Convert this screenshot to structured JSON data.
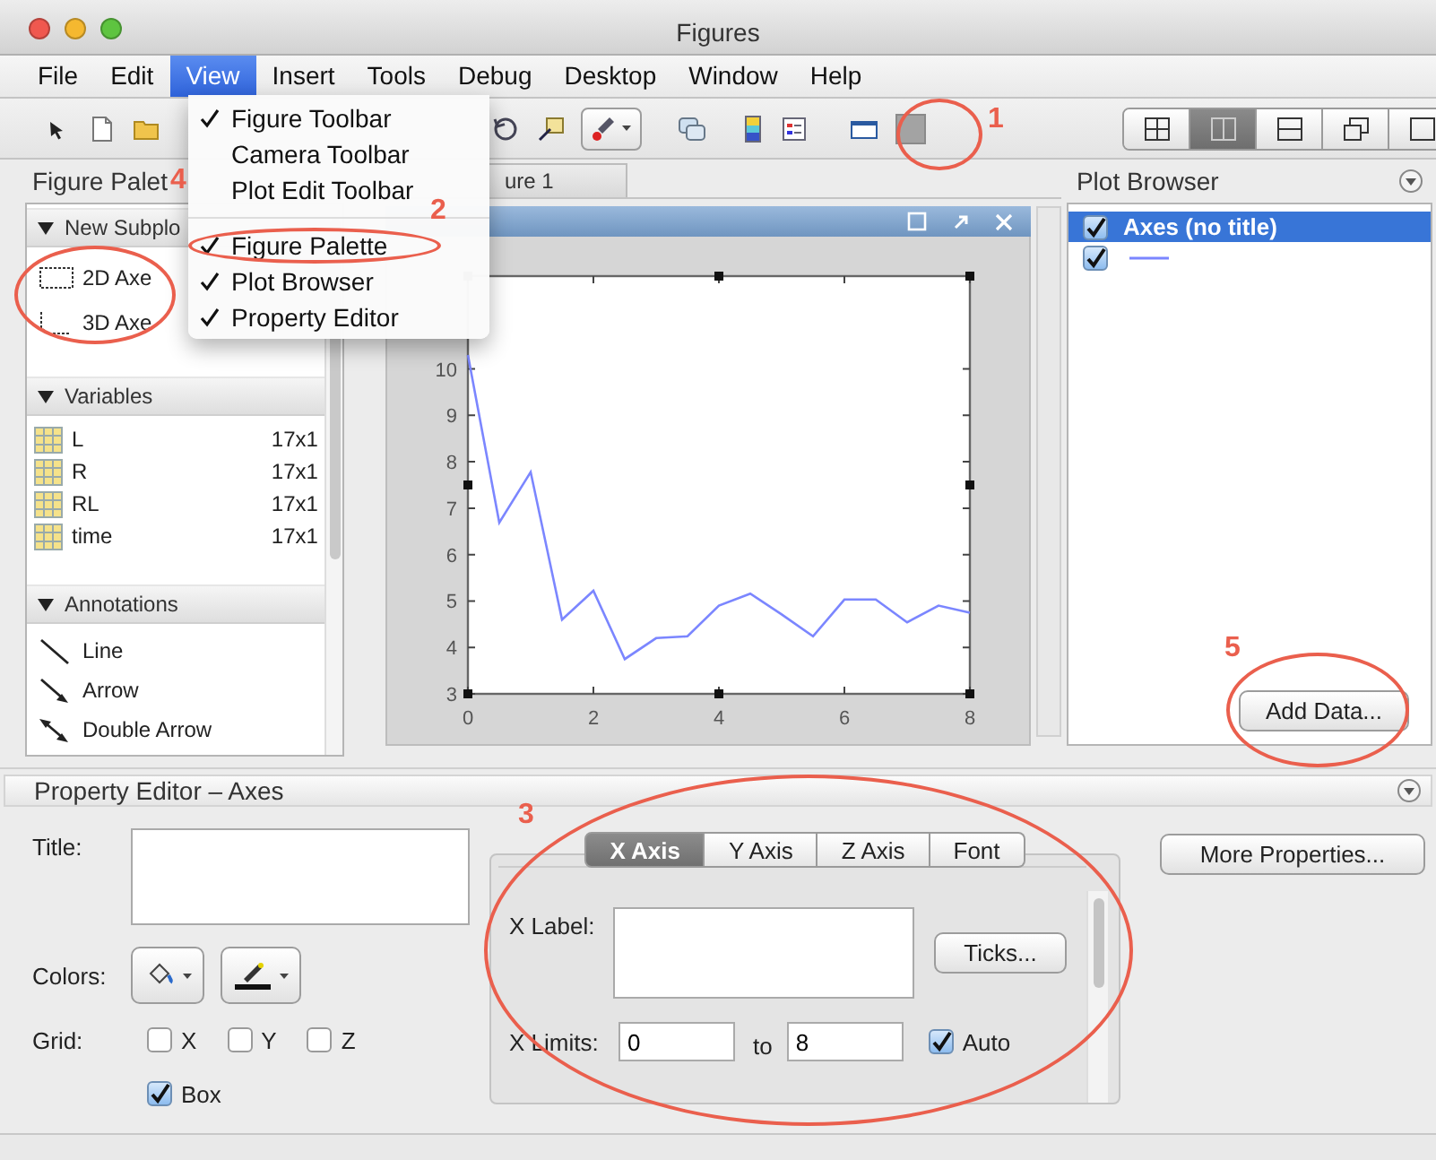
{
  "window": {
    "title": "Figures"
  },
  "menu_bar": [
    {
      "label": "File",
      "selected": false
    },
    {
      "label": "Edit",
      "selected": false
    },
    {
      "label": "View",
      "selected": true
    },
    {
      "label": "Insert",
      "selected": false
    },
    {
      "label": "Tools",
      "selected": false
    },
    {
      "label": "Debug",
      "selected": false
    },
    {
      "label": "Desktop",
      "selected": false
    },
    {
      "label": "Window",
      "selected": false
    },
    {
      "label": "Help",
      "selected": false
    }
  ],
  "toolbar": {
    "layout_buttons": [
      {
        "selected": false
      },
      {
        "selected": true
      },
      {
        "selected": false
      },
      {
        "selected": false
      },
      {
        "selected": false
      }
    ]
  },
  "view_menu": {
    "groups": [
      [
        {
          "label": "Figure Toolbar",
          "checked": true
        },
        {
          "label": "Camera Toolbar",
          "checked": false
        },
        {
          "label": "Plot Edit Toolbar",
          "checked": false
        }
      ],
      [
        {
          "label": "Figure Palette",
          "checked": true
        },
        {
          "label": "Plot Browser",
          "checked": true
        },
        {
          "label": "Property Editor",
          "checked": true
        }
      ]
    ]
  },
  "figure_palette": {
    "title": "Figure Palet",
    "sections": [
      {
        "title": "New Subplo",
        "kind": "tools",
        "items": [
          {
            "label": "2D Axe"
          },
          {
            "label": "3D Axe"
          }
        ]
      },
      {
        "title": "Variables",
        "kind": "variables",
        "items": [
          {
            "name": "L",
            "size": "17x1"
          },
          {
            "name": "R",
            "size": "17x1"
          },
          {
            "name": "RL",
            "size": "17x1"
          },
          {
            "name": "time",
            "size": "17x1"
          }
        ]
      },
      {
        "title": "Annotations",
        "kind": "tools",
        "items": [
          {
            "label": "Line"
          },
          {
            "label": "Arrow"
          },
          {
            "label": "Double Arrow"
          }
        ]
      }
    ]
  },
  "figure": {
    "tab": "ure 1",
    "chart_data": {
      "type": "line",
      "x": [
        0,
        0.5,
        1,
        1.5,
        2,
        2.5,
        3,
        3.5,
        4,
        4.5,
        5,
        5.5,
        6,
        6.5,
        7,
        7.5,
        8
      ],
      "series": [
        {
          "color": "#7b86ff",
          "values": [
            10.3,
            6.69,
            7.78,
            4.6,
            5.22,
            3.75,
            4.2,
            4.24,
            4.9,
            5.16,
            4.71,
            4.24,
            5.03,
            5.03,
            4.54,
            4.9,
            4.75
          ]
        }
      ],
      "xlim": [
        0,
        8
      ],
      "ylim": [
        3,
        12
      ],
      "xticks": [
        0,
        2,
        4,
        6,
        8
      ],
      "yticks": [
        3,
        4,
        5,
        6,
        7,
        8,
        9,
        10
      ]
    }
  },
  "plot_browser": {
    "title": "Plot Browser",
    "rows": [
      {
        "label": "Axes (no title)",
        "checked": true,
        "selected": true,
        "children": [
          {
            "checked": true,
            "selected": false
          }
        ]
      }
    ],
    "add_button": "Add Data..."
  },
  "property_editor": {
    "title": "Property Editor – Axes",
    "title_label": "Title:",
    "colors_label": "Colors:",
    "grid_label": "Grid:",
    "grid": [
      {
        "label": "X",
        "checked": false
      },
      {
        "label": "Y",
        "checked": false
      },
      {
        "label": "Z",
        "checked": false
      }
    ],
    "box": {
      "label": "Box",
      "checked": true
    },
    "tabs": [
      {
        "label": "X Axis",
        "selected": true
      },
      {
        "label": "Y Axis",
        "selected": false
      },
      {
        "label": "Z Axis",
        "selected": false
      },
      {
        "label": "Font",
        "selected": false
      }
    ],
    "x_label_label": "X Label:",
    "ticks_button": "Ticks...",
    "x_limits_label": "X Limits:",
    "x_min": "0",
    "to": "to",
    "x_max": "8",
    "auto": {
      "label": "Auto",
      "checked": true
    },
    "more_button": "More Properties..."
  },
  "callouts": [
    {
      "number": "1"
    },
    {
      "number": "2"
    },
    {
      "number": "3"
    },
    {
      "number": "4"
    },
    {
      "number": "5"
    }
  ]
}
